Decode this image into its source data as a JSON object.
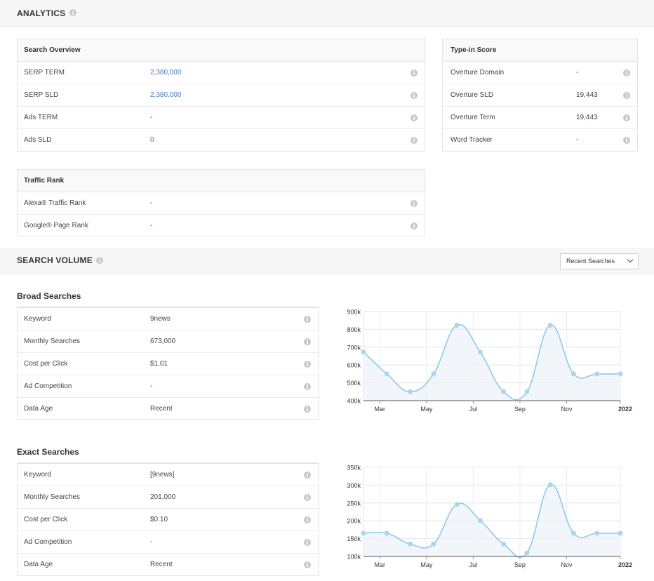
{
  "analytics": {
    "title": "ANALYTICS",
    "search_overview": {
      "title": "Search Overview",
      "rows": [
        {
          "label": "SERP TERM",
          "value": "2,380,000"
        },
        {
          "label": "SERP SLD",
          "value": "2,380,000"
        },
        {
          "label": "Ads TERM",
          "value": "-"
        },
        {
          "label": "Ads SLD",
          "value": "0"
        }
      ]
    },
    "type_in_score": {
      "title": "Type-in Score",
      "rows": [
        {
          "label": "Overture Domain",
          "value": "-"
        },
        {
          "label": "Overture SLD",
          "value": "19,443"
        },
        {
          "label": "Overture Term",
          "value": "19,443"
        },
        {
          "label": "Word Tracker",
          "value": "-"
        }
      ]
    },
    "traffic_rank": {
      "title": "Traffic Rank",
      "rows": [
        {
          "label": "Alexa® Traffic Rank",
          "value": "-"
        },
        {
          "label": "Google® Page Rank",
          "value": "-"
        }
      ]
    }
  },
  "search_volume": {
    "title": "SEARCH VOLUME",
    "dropdown": {
      "selected": "Recent Searches"
    },
    "broad": {
      "title": "Broad Searches",
      "rows": [
        {
          "label": "Keyword",
          "value": "9news"
        },
        {
          "label": "Monthly Searches",
          "value": "673,000"
        },
        {
          "label": "Cost per Click",
          "value": "$1.01"
        },
        {
          "label": "Ad Competition",
          "value": "-"
        },
        {
          "label": "Data Age",
          "value": "Recent"
        }
      ]
    },
    "exact": {
      "title": "Exact Searches",
      "rows": [
        {
          "label": "Keyword",
          "value": "[9news]"
        },
        {
          "label": "Monthly Searches",
          "value": "201,000"
        },
        {
          "label": "Cost per Click",
          "value": "$0.10"
        },
        {
          "label": "Ad Competition",
          "value": "-"
        },
        {
          "label": "Data Age",
          "value": "Recent"
        }
      ]
    }
  },
  "colors": {
    "line": "#8ecae6",
    "point": "#a9d8ee",
    "link": "#4a78c2",
    "header_bg": "#f7f7f7"
  },
  "icons": {
    "info": "info-icon",
    "dropdown": "chevron-down-icon"
  },
  "chart_data": [
    {
      "type": "area",
      "title": "",
      "xlabel": "",
      "ylabel": "",
      "x_tick_labels": [
        "Mar",
        "May",
        "Jul",
        "Sep",
        "Nov",
        "2022"
      ],
      "y_tick_labels": [
        "400k",
        "500k",
        "600k",
        "700k",
        "800k",
        "900k"
      ],
      "ylim": [
        400000,
        900000
      ],
      "grid": true,
      "series": [
        {
          "x": [
            "2021-01",
            "2021-02",
            "2021-03",
            "2021-04",
            "2021-05",
            "2021-06",
            "2021-07",
            "2021-08",
            "2021-09",
            "2021-10",
            "2021-11",
            "2021-12"
          ],
          "values": [
            673000,
            550000,
            450000,
            550000,
            823000,
            673000,
            450000,
            450000,
            823000,
            550000,
            550000,
            550000
          ]
        }
      ]
    },
    {
      "type": "area",
      "title": "",
      "xlabel": "",
      "ylabel": "",
      "x_tick_labels": [
        "Mar",
        "May",
        "Jul",
        "Sep",
        "Nov",
        "2022"
      ],
      "y_tick_labels": [
        "100k",
        "150k",
        "200k",
        "250k",
        "300k",
        "350k"
      ],
      "ylim": [
        100000,
        350000
      ],
      "grid": true,
      "series": [
        {
          "x": [
            "2021-01",
            "2021-02",
            "2021-03",
            "2021-04",
            "2021-05",
            "2021-06",
            "2021-07",
            "2021-08",
            "2021-09",
            "2021-10",
            "2021-11",
            "2021-12"
          ],
          "values": [
            165000,
            165000,
            135000,
            135000,
            246000,
            201000,
            135000,
            110000,
            301000,
            165000,
            165000,
            165000
          ]
        }
      ]
    }
  ]
}
